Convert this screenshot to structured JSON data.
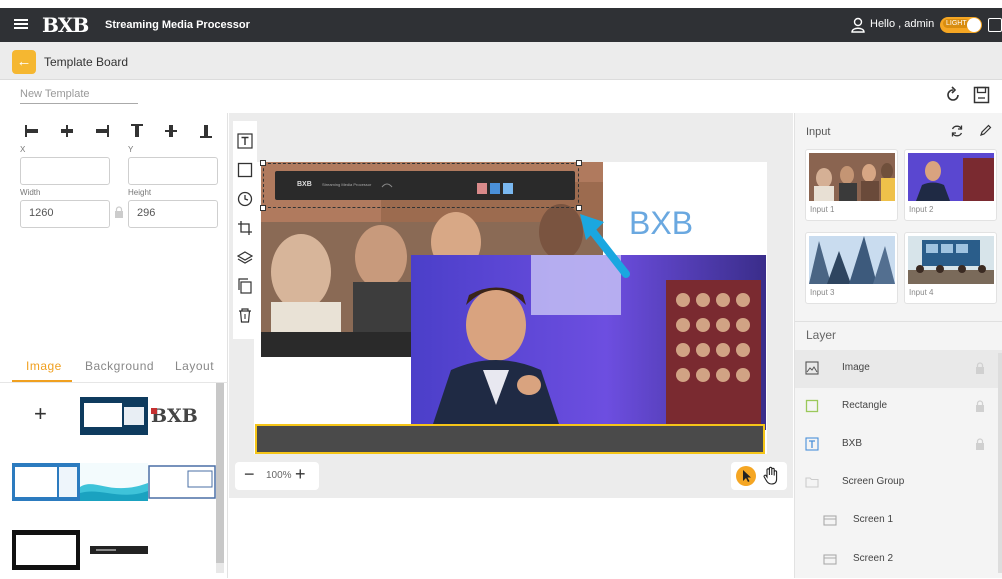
{
  "app": {
    "logo_text": "BXB",
    "title": "Streaming Media Processor",
    "greeting": "Hello , admin",
    "theme_label": "LIGHT"
  },
  "header": {
    "back_icon": "arrow-left-icon",
    "page_title": "Template Board"
  },
  "template": {
    "name_placeholder": "New Template"
  },
  "properties": {
    "x_label": "X",
    "y_label": "Y",
    "x_value": "",
    "y_value": "",
    "width_label": "Width",
    "height_label": "Height",
    "width_value": "1260",
    "height_value": "296"
  },
  "library": {
    "tabs": [
      "Image",
      "Background",
      "Layout"
    ],
    "active_tab": "Image",
    "add_symbol": "+",
    "logo_thumb_text": "BXB"
  },
  "canvas": {
    "overlay_text": "BXB",
    "preview_logo": "BXB",
    "preview_title": "Streaming Media Processor",
    "zoom_level": "100%",
    "zoom_out": "−",
    "zoom_in": "+",
    "selection_color": "#333333",
    "ticker_border_color": "#f5c518",
    "arrow_color": "#1aa7e0"
  },
  "inputs": {
    "title": "Input",
    "items": [
      {
        "label": "Input 1"
      },
      {
        "label": "Input 2"
      },
      {
        "label": "Input 3"
      },
      {
        "label": "Input 4"
      }
    ]
  },
  "layers": {
    "title": "Layer",
    "items": [
      {
        "name": "Image",
        "icon": "image-icon"
      },
      {
        "name": "Rectangle",
        "icon": "rectangle-icon"
      },
      {
        "name": "BXB",
        "icon": "text-icon"
      },
      {
        "name": "Screen Group",
        "icon": "folder-icon"
      },
      {
        "name": "Screen 1",
        "icon": "screen-icon"
      },
      {
        "name": "Screen 2",
        "icon": "screen-icon"
      }
    ]
  },
  "colors": {
    "accent": "#f5a623",
    "topbar": "#2f3135",
    "canvas_bg": "#ececec"
  }
}
